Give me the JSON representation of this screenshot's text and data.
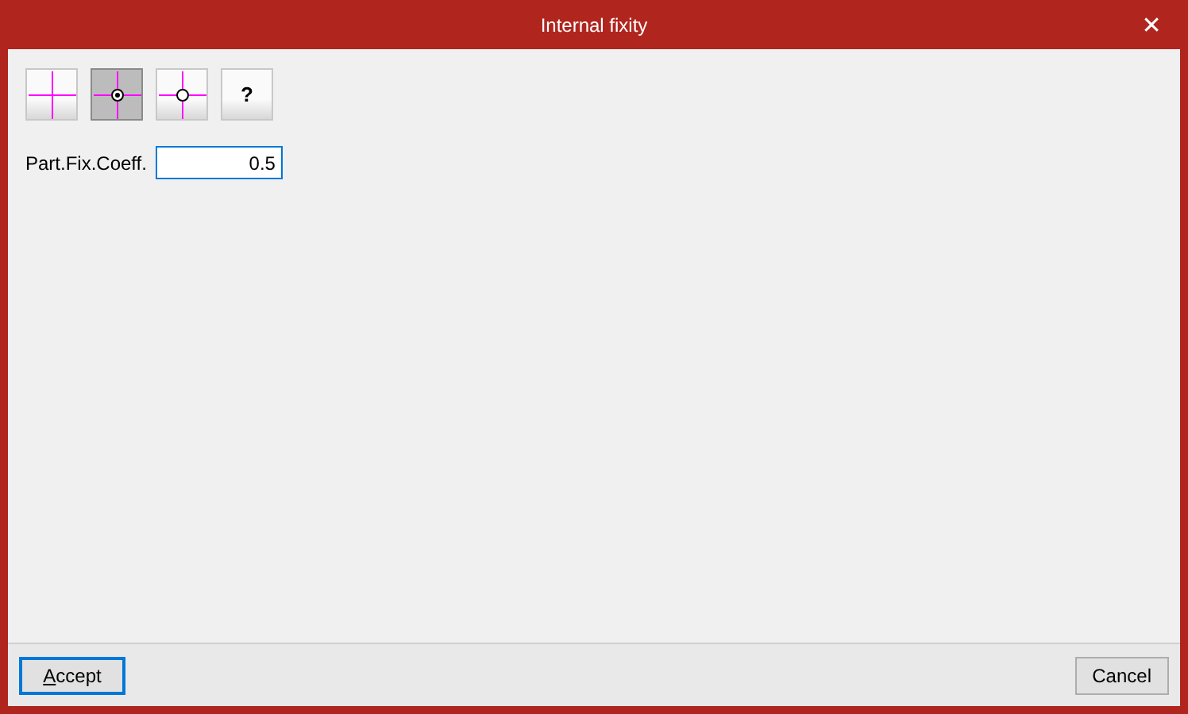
{
  "window": {
    "title": "Internal fixity",
    "close": "✕"
  },
  "toolbar": [
    {
      "kind": "fixed",
      "selected": false
    },
    {
      "kind": "partial",
      "selected": true
    },
    {
      "kind": "hinged",
      "selected": false
    },
    {
      "kind": "help",
      "label": "?",
      "selected": false
    }
  ],
  "field": {
    "label": "Part.Fix.Coeff.",
    "value": "0.5"
  },
  "buttons": [
    {
      "label": "Accept",
      "mnemonic": true,
      "default": true
    },
    {
      "label": "Cancel",
      "default": false
    }
  ]
}
